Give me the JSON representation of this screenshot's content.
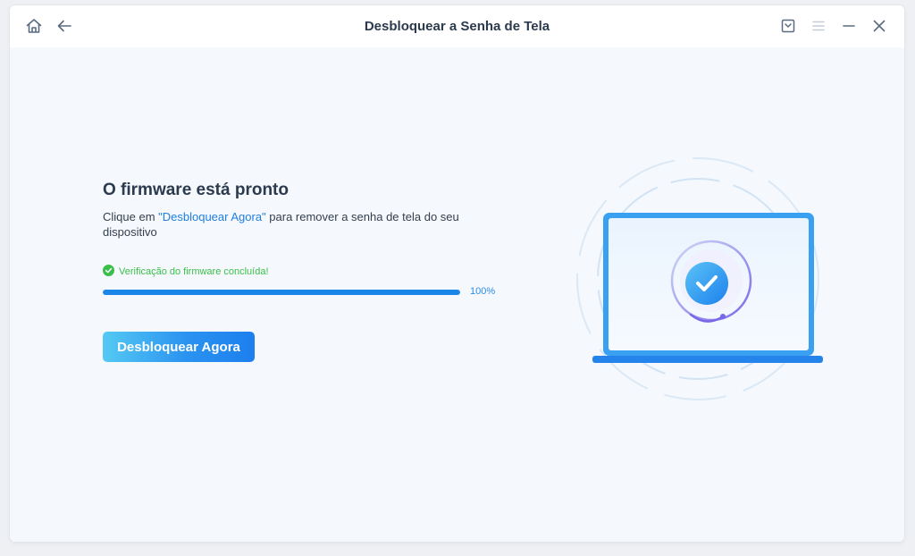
{
  "window": {
    "title": "Desbloquear a Senha de Tela",
    "left_icons": [
      "home-icon",
      "back-arrow-icon"
    ],
    "right_icons": [
      "feedback-icon",
      "menu-icon",
      "minimize-icon",
      "close-icon"
    ]
  },
  "main": {
    "heading": "O firmware está pronto",
    "description_before": "Clique em ",
    "description_highlight": "\"Desbloquear Agora\"",
    "description_after": " para remover a senha de tela do seu dispositivo",
    "status_text": "Verificação do firmware concluída!",
    "progress_value": 100,
    "progress_label": "100%",
    "unlock_button": "Desbloquear Agora"
  },
  "colors": {
    "accent": "#1a86e8",
    "success": "#3bbf4a",
    "title_text": "#2c3a4d"
  }
}
